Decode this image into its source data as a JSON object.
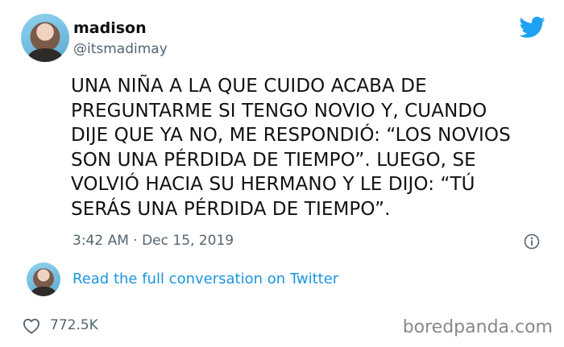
{
  "tweet": {
    "display_name": "madison",
    "handle": "@itsmadimay",
    "text_lines": [
      "UNA NIÑA A LA QUE CUIDO ACABA DE",
      "PREGUNTARME SI TENGO NOVIO Y, CUANDO",
      "DIJE QUE YA NO, ME RESPONDIÓ: “LOS NOVIOS",
      "SON UNA PÉRDIDA DE TIEMPO”. LUEGO, SE",
      "VOLVIÓ HACIA SU HERMANO Y LE DIJO: “TÚ",
      "SERÁS UNA PÉRDIDA DE TIEMPO”."
    ],
    "timestamp": "3:42 AM · Dec 15, 2019",
    "conversation_link": "Read the full conversation on Twitter",
    "likes": "772.5K"
  },
  "watermark": "boredpanda.com",
  "icons": {
    "brand": "twitter-bird-icon",
    "info": "info-icon",
    "like": "heart-icon"
  },
  "colors": {
    "brand_blue": "#1da1f2",
    "link_blue": "#1b95e0",
    "muted_gray": "#536471"
  }
}
